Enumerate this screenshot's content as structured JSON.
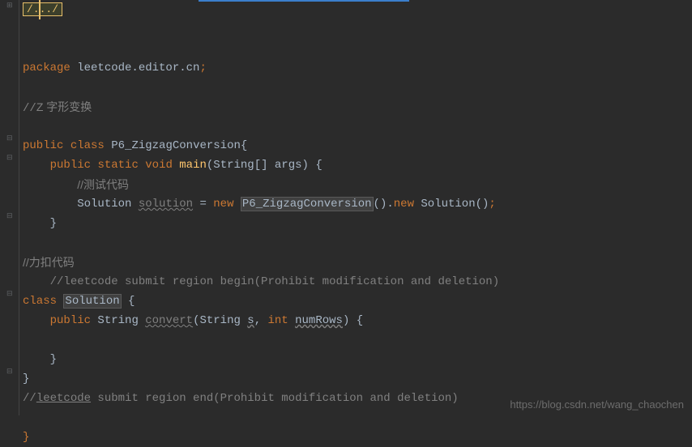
{
  "fold_marker": "/.../",
  "code": {
    "l1_package": "package",
    "l1_pkgname": "leetcode.editor.cn",
    "l2_comment_prefix": "//",
    "l2_comment_text": "Z 字形变换",
    "l3_public": "public",
    "l3_class": "class",
    "l3_classname": "P6_ZigzagConversion",
    "l3_brace": "{",
    "l4_public": "public",
    "l4_static": "static",
    "l4_void": "void",
    "l4_main": "main",
    "l4_params": "(String[] args) {",
    "l5_comment": "//测试代码",
    "l6_type": "Solution",
    "l6_var": "solution",
    "l6_eq": " = ",
    "l6_new1": "new",
    "l6_cls": "P6_ZigzagConversion",
    "l6_paren1": "().",
    "l6_new2": "new",
    "l6_sol": " Solution()",
    "l6_semi": ";",
    "l7_brace": "}",
    "l8_comment": "//力扣代码",
    "l9_comment": "//leetcode submit region begin(Prohibit modification and deletion)",
    "l10_class": "class",
    "l10_name": "Solution",
    "l10_brace": " {",
    "l11_public": "public",
    "l11_rettype": " String ",
    "l11_method": "convert",
    "l11_p1": "(String ",
    "l11_pn1": "s",
    "l11_p2": ", ",
    "l11_int": "int",
    "l11_sp": " ",
    "l11_pn2": "numRows",
    "l11_p3": ") {",
    "l12_brace": "}",
    "l13_brace": "}",
    "l14_comment": "//",
    "l14_lc": "leetcode",
    "l14_rest": " submit region end(Prohibit modification and deletion)",
    "l15_brace": "}"
  },
  "watermark": "https://blog.csdn.net/wang_chaochen"
}
